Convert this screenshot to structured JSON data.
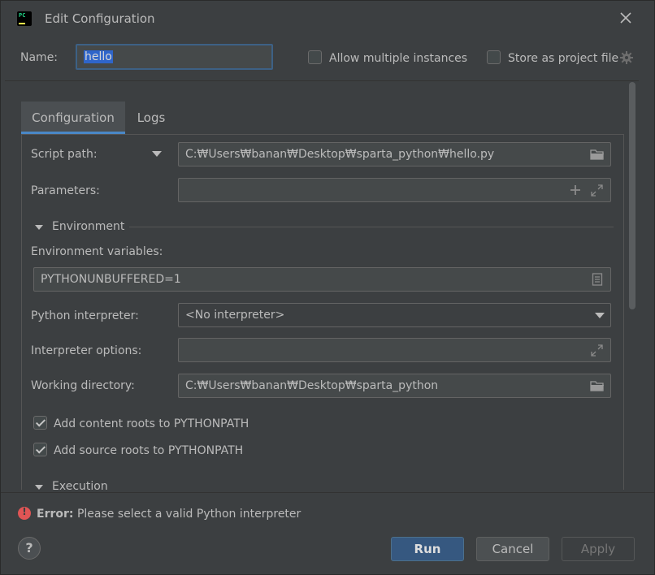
{
  "window": {
    "title": "Edit Configuration",
    "app_icon": "pycharm-icon",
    "app_icon_text": "PC"
  },
  "name_row": {
    "label": "Name:",
    "value": "hello",
    "allow_multiple_label": "Allow multiple instances",
    "allow_multiple_checked": false,
    "store_project_label": "Store as project file",
    "store_project_checked": false
  },
  "tabs": [
    {
      "label": "Configuration",
      "active": true
    },
    {
      "label": "Logs",
      "active": false
    }
  ],
  "form": {
    "script_path_label": "Script path:",
    "script_path_value": "C:₩Users₩banan₩Desktop₩sparta_python₩hello.py",
    "parameters_label": "Parameters:",
    "parameters_value": "",
    "environment_section": "Environment",
    "env_vars_label": "Environment variables:",
    "env_vars_value": "PYTHONUNBUFFERED=1",
    "interpreter_label": "Python interpreter:",
    "interpreter_value": "<No interpreter>",
    "interpreter_options_label": "Interpreter options:",
    "interpreter_options_value": "",
    "working_dir_label": "Working directory:",
    "working_dir_value": "C:₩Users₩banan₩Desktop₩sparta_python",
    "content_roots_label": "Add content roots to PYTHONPATH",
    "content_roots_checked": true,
    "source_roots_label": "Add source roots to PYTHONPATH",
    "source_roots_checked": true,
    "execution_section": "Execution"
  },
  "footer": {
    "error_prefix": "Error:",
    "error_message": " Please select a valid Python interpreter",
    "help_label": "?",
    "run_label": "Run",
    "cancel_label": "Cancel",
    "apply_label": "Apply"
  },
  "colors": {
    "dialog_bg": "#3c3f41",
    "field_bg": "#45494a",
    "accent_blue": "#4a88c7",
    "run_button": "#365880",
    "error_red": "#e05555"
  }
}
